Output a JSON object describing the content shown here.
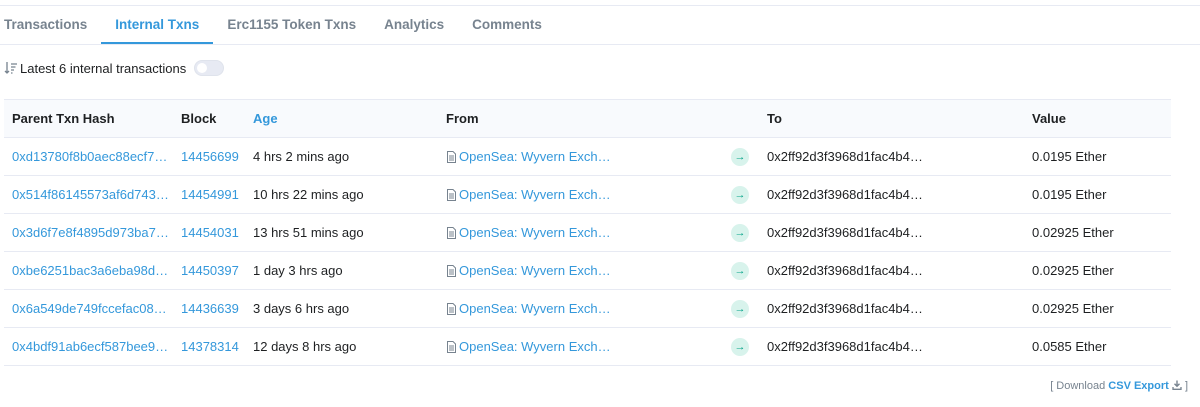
{
  "tabs": [
    {
      "label": "Transactions"
    },
    {
      "label": "Internal Txns"
    },
    {
      "label": "Erc1155 Token Txns"
    },
    {
      "label": "Analytics"
    },
    {
      "label": "Comments"
    }
  ],
  "summary": {
    "text": "Latest 6 internal transactions"
  },
  "table": {
    "headers": {
      "hash": "Parent Txn Hash",
      "block": "Block",
      "age": "Age",
      "from": "From",
      "to": "To",
      "value": "Value"
    },
    "rows": [
      {
        "hash": "0xd13780f8b0aec88ecf7…",
        "block": "14456699",
        "age": "4 hrs 2 mins ago",
        "from": "OpenSea: Wyvern Exch…",
        "to": "0x2ff92d3f3968d1fac4b4…",
        "value": "0.0195 Ether"
      },
      {
        "hash": "0x514f86145573af6d743…",
        "block": "14454991",
        "age": "10 hrs 22 mins ago",
        "from": "OpenSea: Wyvern Exch…",
        "to": "0x2ff92d3f3968d1fac4b4…",
        "value": "0.0195 Ether"
      },
      {
        "hash": "0x3d6f7e8f4895d973ba7…",
        "block": "14454031",
        "age": "13 hrs 51 mins ago",
        "from": "OpenSea: Wyvern Exch…",
        "to": "0x2ff92d3f3968d1fac4b4…",
        "value": "0.02925 Ether"
      },
      {
        "hash": "0xbe6251bac3a6eba98d…",
        "block": "14450397",
        "age": "1 day 3 hrs ago",
        "from": "OpenSea: Wyvern Exch…",
        "to": "0x2ff92d3f3968d1fac4b4…",
        "value": "0.02925 Ether"
      },
      {
        "hash": "0x6a549de749fccefac08…",
        "block": "14436639",
        "age": "3 days 6 hrs ago",
        "from": "OpenSea: Wyvern Exch…",
        "to": "0x2ff92d3f3968d1fac4b4…",
        "value": "0.02925 Ether"
      },
      {
        "hash": "0x4bdf91ab6ecf587bee9…",
        "block": "14378314",
        "age": "12 days 8 hrs ago",
        "from": "OpenSea: Wyvern Exch…",
        "to": "0x2ff92d3f3968d1fac4b4…",
        "value": "0.0585 Ether"
      }
    ]
  },
  "footer": {
    "prefix": "[ Download",
    "link": "CSV Export",
    "suffix": "]"
  },
  "colors": {
    "accent": "#3498db",
    "arrow_bg": "#d8f3ec",
    "arrow_fg": "#00a186"
  },
  "icons": {
    "sort": "sort-icon",
    "contract": "document-icon",
    "direction": "arrow-right-icon",
    "download": "download-icon"
  }
}
